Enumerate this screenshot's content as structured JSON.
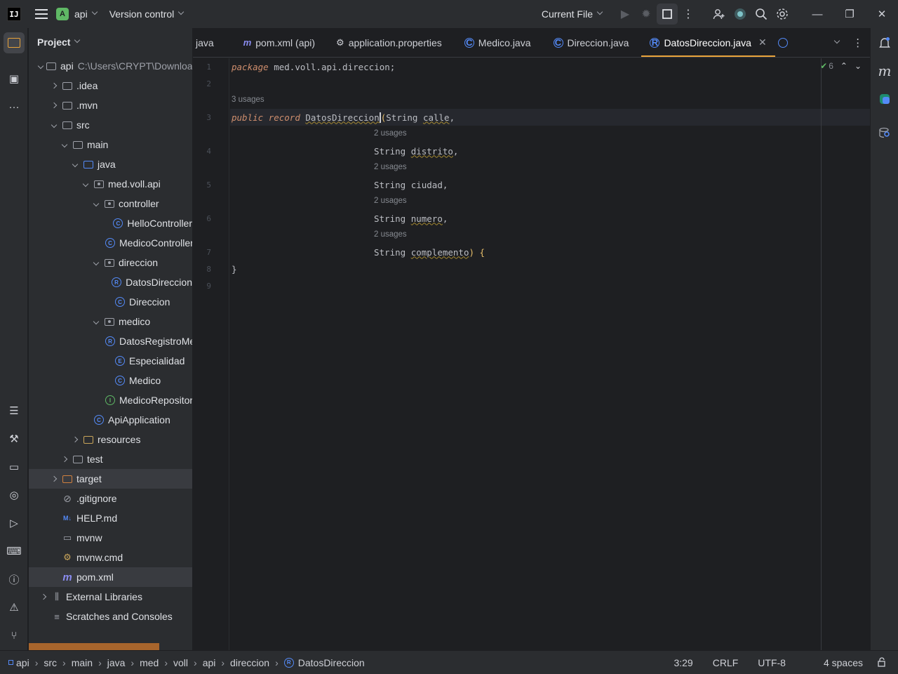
{
  "titlebar": {
    "project_badge": "A",
    "project_name": "api",
    "vcs_label": "Version control",
    "run_config": "Current File"
  },
  "project_panel": {
    "title": "Project",
    "tree": [
      {
        "label": "api",
        "hint": "C:\\Users\\CRYPT\\Downloads",
        "icon": "folder-icon",
        "expanded": true
      },
      {
        "label": ".idea",
        "icon": "folder-icon",
        "expanded": false
      },
      {
        "label": ".mvn",
        "icon": "folder-icon",
        "expanded": false
      },
      {
        "label": "src",
        "icon": "folder-icon",
        "expanded": true
      },
      {
        "label": "main",
        "icon": "folder-icon",
        "expanded": true
      },
      {
        "label": "java",
        "icon": "source-folder-icon",
        "expanded": true
      },
      {
        "label": "med.voll.api",
        "icon": "package-icon",
        "expanded": true
      },
      {
        "label": "controller",
        "icon": "package-icon",
        "expanded": true
      },
      {
        "label": "HelloController",
        "icon": "class-icon"
      },
      {
        "label": "MedicoController",
        "icon": "class-icon"
      },
      {
        "label": "direccion",
        "icon": "package-icon",
        "expanded": true
      },
      {
        "label": "DatosDireccion",
        "icon": "record-icon"
      },
      {
        "label": "Direccion",
        "icon": "class-icon"
      },
      {
        "label": "medico",
        "icon": "package-icon",
        "expanded": true
      },
      {
        "label": "DatosRegistroMedico",
        "icon": "record-icon"
      },
      {
        "label": "Especialidad",
        "icon": "enum-icon"
      },
      {
        "label": "Medico",
        "icon": "class-icon"
      },
      {
        "label": "MedicoRepository",
        "icon": "interface-icon"
      },
      {
        "label": "ApiApplication",
        "icon": "class-icon"
      },
      {
        "label": "resources",
        "icon": "resources-folder-icon",
        "expanded": false
      },
      {
        "label": "test",
        "icon": "folder-icon",
        "expanded": false
      },
      {
        "label": "target",
        "icon": "excluded-folder-icon",
        "expanded": false
      },
      {
        "label": ".gitignore",
        "icon": "ignore-file-icon"
      },
      {
        "label": "HELP.md",
        "icon": "markdown-icon"
      },
      {
        "label": "mvnw",
        "icon": "terminal-file-icon"
      },
      {
        "label": "mvnw.cmd",
        "icon": "script-icon"
      },
      {
        "label": "pom.xml",
        "icon": "maven-icon"
      },
      {
        "label": "External Libraries",
        "icon": "library-icon",
        "expanded": false
      },
      {
        "label": "Scratches and Consoles",
        "icon": "scratches-icon"
      }
    ]
  },
  "tabs": [
    {
      "label": "java",
      "icon": ""
    },
    {
      "label": "pom.xml (api)",
      "icon": "maven-icon"
    },
    {
      "label": "application.properties",
      "icon": "gear-icon"
    },
    {
      "label": "Medico.java",
      "icon": "class-icon"
    },
    {
      "label": "Direccion.java",
      "icon": "class-icon"
    },
    {
      "label": "DatosDireccion.java",
      "icon": "record-icon",
      "active": true
    }
  ],
  "editor": {
    "inspection_count": "6",
    "usages_3": "3 usages",
    "usages_2": "2 usages",
    "line_numbers": [
      "1",
      "2",
      "3",
      "4",
      "5",
      "6",
      "7",
      "8",
      "9"
    ],
    "line1_kw": "package",
    "line1_rest": " med.voll.api.direccion;",
    "line3_public": "public",
    "line3_record": "record",
    "record_name": "DatosDireccion",
    "type_string": "String",
    "fields": [
      "calle",
      "distrito",
      "ciudad",
      "numero",
      "complemento"
    ],
    "closing_brace": "}"
  },
  "statusbar": {
    "breadcrumbs": [
      "api",
      "src",
      "main",
      "java",
      "med",
      "voll",
      "api",
      "direccion",
      "DatosDireccion"
    ],
    "position": "3:29",
    "line_ending": "CRLF",
    "encoding": "UTF-8",
    "indent": "4 spaces"
  },
  "colors": {
    "accent": "#e8a33a",
    "class_icon": "#548af7",
    "keyword": "#cf8e6d"
  }
}
